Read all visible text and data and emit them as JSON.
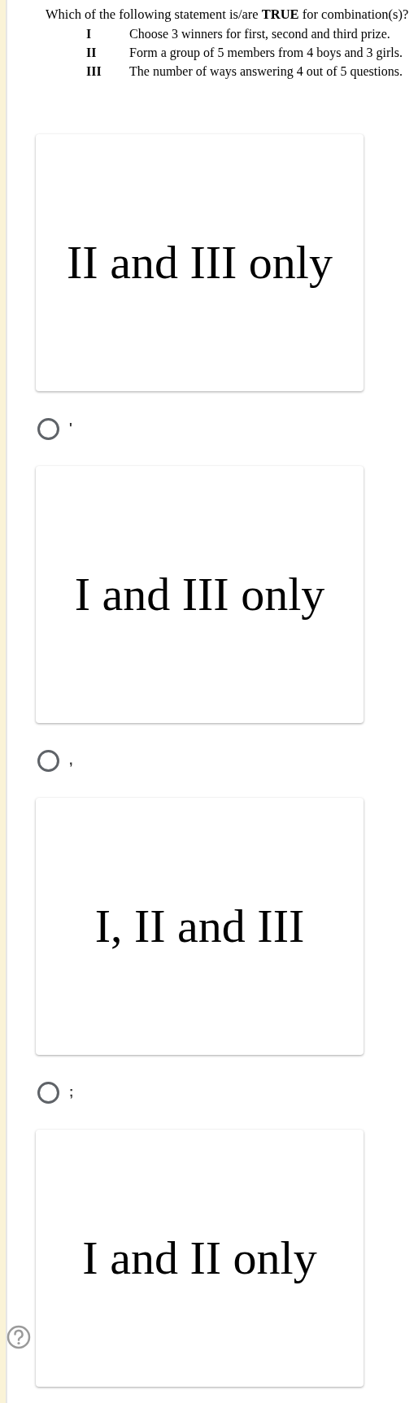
{
  "question": "Which of the following statement is/are **TRUE** for combination(s)?",
  "statements": [
    {
      "numeral": "I",
      "text": "Choose 3 winners for first, second and third prize."
    },
    {
      "numeral": "II",
      "text": "Form a group of 5 members from 4 boys and 3 girls."
    },
    {
      "numeral": "III",
      "text": "The number of ways answering 4 out of 5 questions."
    }
  ],
  "options": [
    {
      "text": "II and III only",
      "mark": "'",
      "selected": false
    },
    {
      "text": "I and III only",
      "mark": ",",
      "selected": false
    },
    {
      "text": "I, II and III",
      "mark": ";",
      "selected": false
    },
    {
      "text": "I and II only"
    }
  ]
}
